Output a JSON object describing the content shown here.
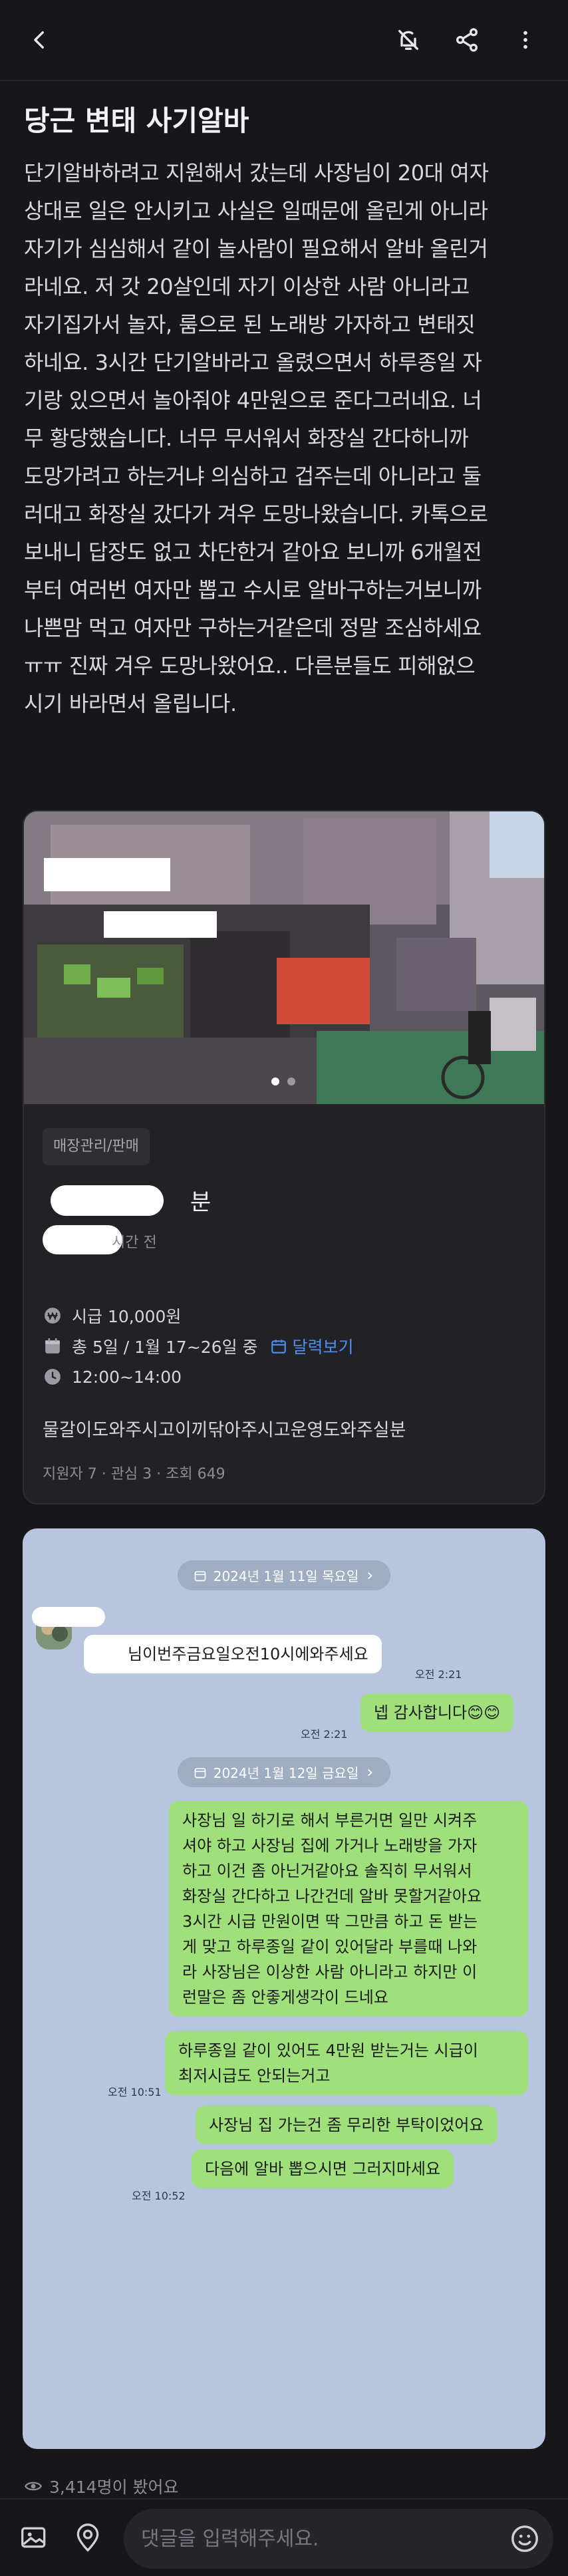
{
  "header": {
    "back_icon": "chevron-left-icon",
    "mute_icon": "bell-off-icon",
    "share_icon": "share-icon",
    "more_icon": "more-vertical-icon"
  },
  "post": {
    "title": "당근 변태 사기알바",
    "body": "단기알바하려고 지원해서 갔는데 사장님이 20대 여자\n상대로 일은 안시키고 사실은 일때문에 올린게 아니라\n자기가 심심해서 같이 놀사람이 필요해서 알바 올린거\n라네요. 저 갓 20살인데 자기 이상한 사람 아니라고\n자기집가서 놀자, 룸으로 된 노래방 가자하고 변태짓\n하네요. 3시간 단기알바라고 올렸으면서 하루종일 자\n기랑 있으면서 놀아줘야 4만원으로 준다그러네요. 너\n무 황당했습니다. 너무 무서워서 화장실 간다하니까\n도망가려고 하는거냐 의심하고 겁주는데 아니라고 둘\n러대고 화장실 갔다가 겨우 도망나왔습니다. 카톡으로\n보내니 답장도 없고 차단한거 같아요 보니까 6개월전\n부터 여러번 여자만 뽑고 수시로 알바구하는거보니까\n나쁜맘 먹고 여자만 구하는거같은데 정말 조심하세요\nㅠㅠ 진짜 겨우 도망나왔어요.. 다른분들도 피해없으\n시기 바라면서 올립니다."
  },
  "job": {
    "category": "매장관리/판매",
    "title_suffix": "분",
    "time_ago": "시간 전",
    "wage": "시급 10,000원",
    "schedule": "총 5일 / 1월 17~26일 중",
    "calendar_link": "달력보기",
    "hours": "12:00~14:00",
    "description": "물갈이도와주시고이끼닦아주시고운영도와주실분",
    "stats": "지원자 7 · 관심 3 · 조회 649"
  },
  "chat": {
    "date1": "2024년 1월 11일 목요일",
    "msg1": "님이번주금요일오전10시에와주세요",
    "time1": "오전 2:21",
    "reply1": "넵 감사합니다😊😊",
    "time2": "오전 2:21",
    "date2": "2024년 1월 12일 금요일",
    "reply2": "사장님 일 하기로 해서 부른거면 일만 시켜주\n셔야 하고 사장님 집에 가거나 노래방을 가자\n하고 이건 좀 아닌거같아요 솔직히 무서워서\n화장실 간다하고 나간건데 알바 못할거같아요\n3시간 시급 만원이면 딱 그만큼 하고 돈 받는\n게 맞고 하루종일 같이 있어달라 부를때 나와\n라 사장님은 이상한 사람 아니라고 하지만 이\n런말은 좀 안좋게생각이 드네요",
    "reply3": "하루종일 같이 있어도 4만원 받는거는 시급이\n최저시급도 안되는거고",
    "time3": "오전 10:51",
    "reply4": "사장님 집 가는건 좀 무리한 부탁이었어요",
    "reply5": "다음에 알바 뽑으시면 그러지마세요",
    "time4": "오전 10:52"
  },
  "footer": {
    "views": "3,414명이 봤어요",
    "comment_placeholder": "댓글을 입력해주세요."
  },
  "colors": {
    "background": "#17171a",
    "accent_link": "#4b8ff0",
    "chat_bg": "#b7c6de",
    "bubble_yellow": "#f9ec62"
  }
}
